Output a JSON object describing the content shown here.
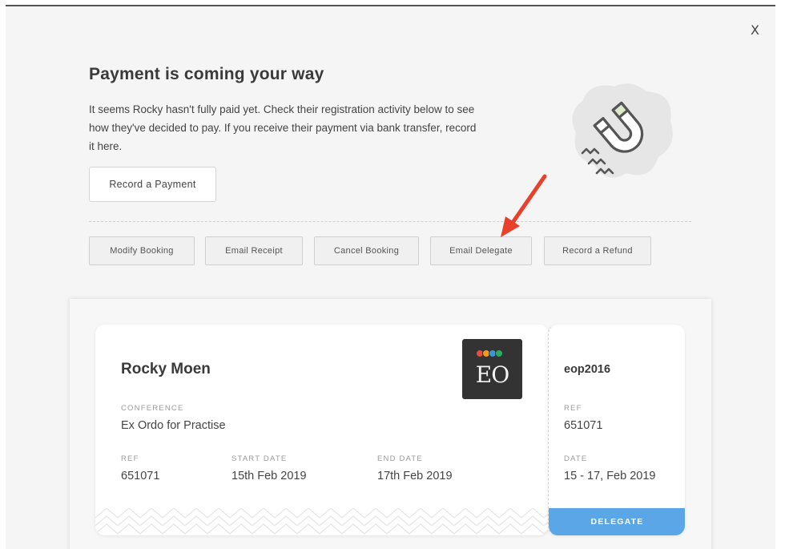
{
  "modal": {
    "close_label": "X",
    "title": "Payment is coming your way",
    "description": "It seems Rocky hasn't fully paid yet. Check their registration activity below to see how they've decided to pay. If you receive their payment via bank transfer, record it here.",
    "record_payment_label": "Record a Payment"
  },
  "actions": [
    {
      "label": "Modify Booking"
    },
    {
      "label": "Email Receipt"
    },
    {
      "label": "Cancel Booking"
    },
    {
      "label": "Email Delegate"
    },
    {
      "label": "Record a Refund"
    }
  ],
  "ticket": {
    "name": "Rocky Moen",
    "conference_label": "CONFERENCE",
    "conference_value": "Ex Ordo for Practise",
    "ref_label": "REF",
    "ref_value": "651071",
    "start_label": "START DATE",
    "start_value": "15th Feb 2019",
    "end_label": "END DATE",
    "end_value": "17th Feb 2019",
    "logo_text": "EO",
    "logo_dot_colors": [
      "#e74c3c",
      "#f39c12",
      "#3498db",
      "#27ae60"
    ]
  },
  "stub": {
    "code": "eop2016",
    "ref_label": "REF",
    "ref_value": "651071",
    "date_label": "DATE",
    "date_value": "15 - 17, Feb 2019",
    "badge": "DELEGATE"
  },
  "colors": {
    "accent": "#5aa6e6",
    "arrow": "#e8402a",
    "magnet_tip": "#dde9c8"
  }
}
